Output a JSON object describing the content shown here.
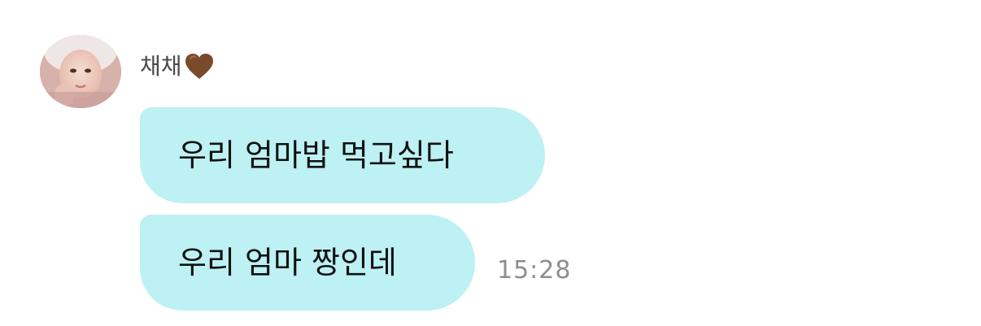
{
  "chat": {
    "sender": {
      "name": "채채",
      "name_icon": "brown-heart-icon",
      "avatar_icon": "avatar-photo"
    },
    "messages": [
      {
        "text": "우리 엄마밥 먹고싶다"
      },
      {
        "text": "우리 엄마 짱인데"
      }
    ],
    "timestamp": "15:28"
  },
  "colors": {
    "bubble": "#bdf1f4",
    "heart": "#7a4a2c",
    "timestamp": "#8e8e8e",
    "name": "#4a4a4a"
  }
}
